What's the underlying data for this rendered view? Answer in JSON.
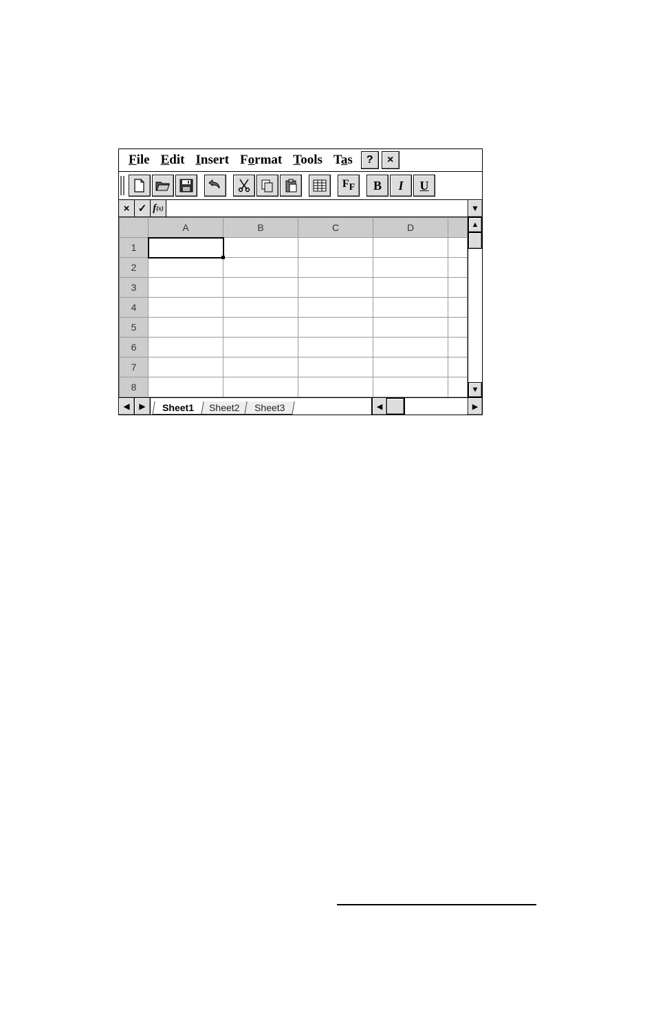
{
  "menus": {
    "file": {
      "pre": "",
      "ul": "F",
      "post": "ile"
    },
    "edit": {
      "pre": "",
      "ul": "E",
      "post": "dit"
    },
    "insert": {
      "pre": "",
      "ul": "I",
      "post": "nsert"
    },
    "format": {
      "pre": "F",
      "ul": "o",
      "post": "rmat"
    },
    "tools": {
      "pre": "",
      "ul": "T",
      "post": "ools"
    },
    "tas": {
      "pre": "T",
      "ul": "a",
      "post": "s"
    },
    "help_label": "?",
    "close_label": "×"
  },
  "toolbar": {
    "bold": "B",
    "italic": "I",
    "underline": "U",
    "font_big": "F",
    "font_sub": "F"
  },
  "formula_bar": {
    "cancel_label": "×",
    "accept_label": "✓",
    "fx_label": "f",
    "fx_sub": "(x)",
    "value": "",
    "dropdown": "▼"
  },
  "columns": [
    "A",
    "B",
    "C",
    "D"
  ],
  "rows": [
    "1",
    "2",
    "3",
    "4",
    "5",
    "6",
    "7",
    "8"
  ],
  "cells": {},
  "selected_cell": "A1",
  "scroll": {
    "up": "▲",
    "down": "▼",
    "left": "◀",
    "right": "▶"
  },
  "tabs": {
    "nav_first": "◀",
    "nav_last": "▶",
    "sheets": [
      {
        "label": "Sheet1",
        "active": true
      },
      {
        "label": "Sheet2",
        "active": false
      },
      {
        "label": "Sheet3",
        "active": false
      }
    ]
  }
}
